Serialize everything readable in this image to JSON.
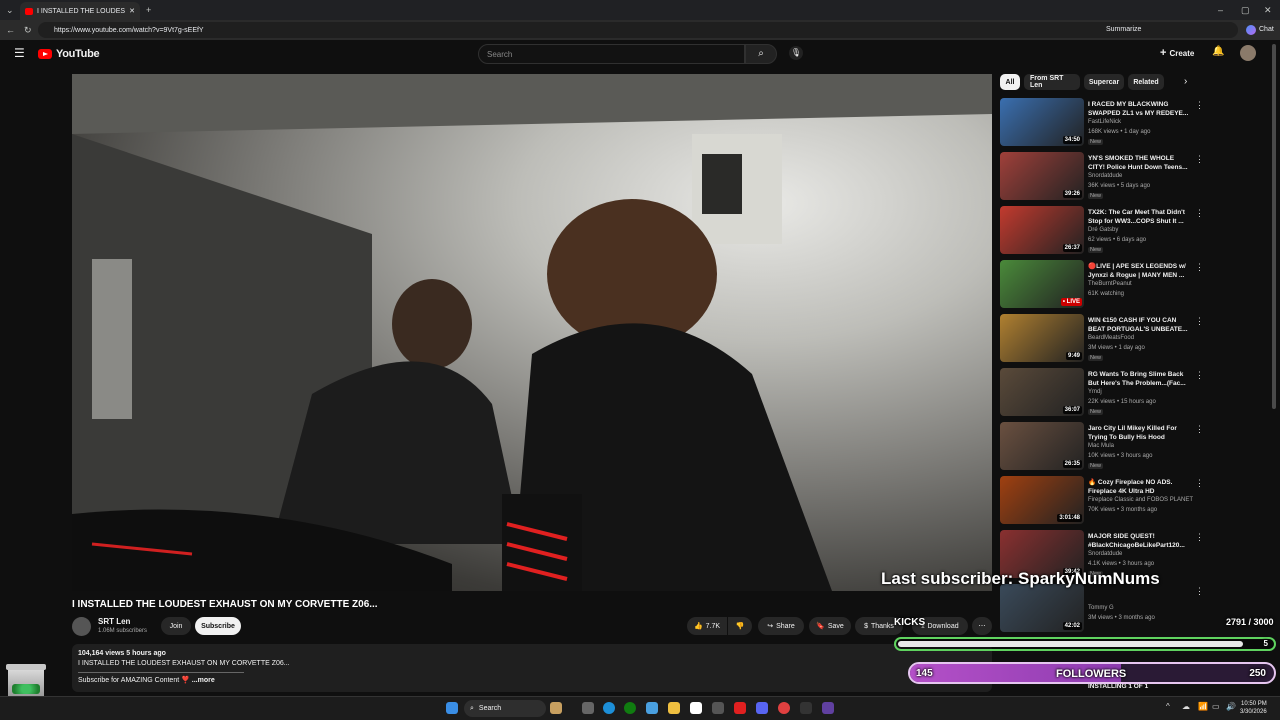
{
  "browser": {
    "tab_title": "I INSTALLED THE LOUDEST EX",
    "url": "https://www.youtube.com/watch?v=9Vt7g-sEEfY",
    "summarize_label": "Summarize",
    "chat_label": "Chat"
  },
  "header": {
    "logo_text": "YouTube",
    "search_placeholder": "Search",
    "create_label": "Create"
  },
  "video": {
    "title": "I INSTALLED THE LOUDEST EXHAUST ON MY CORVETTE Z06...",
    "channel": "SRT Len",
    "subscribers": "1.06M subscribers",
    "join_label": "Join",
    "subscribe_label": "Subscribe",
    "likes": "7.7K",
    "share_label": "Share",
    "save_label": "Save",
    "thanks_label": "Thanks",
    "download_label": "Download"
  },
  "description": {
    "views_time": "104,164 views  5 hours ago",
    "line1": "I INSTALLED THE LOUDEST EXHAUST ON MY CORVETTE Z06...",
    "line2": "Subscribe for AMAZING Content ❣️",
    "more": "...more"
  },
  "chips": [
    "All",
    "From SRT Len",
    "Supercar",
    "Related"
  ],
  "recommendations": [
    {
      "title": "I RACED MY BLACKWING SWAPPED ZL1 vs MY REDEYE...",
      "channel": "FastLifeNick",
      "meta": "168K views • 1 day ago",
      "duration": "34:50",
      "badge": "New",
      "color": "#3a6fb0"
    },
    {
      "title": "YN'S SMOKED THE WHOLE CITY! Police Hunt Down Teens...",
      "channel": "Snordatdude",
      "meta": "36K views • 5 days ago",
      "duration": "39:26",
      "badge": "New",
      "color": "#a0403a"
    },
    {
      "title": "TX2K: The Car Meet That Didn't Stop for WW3...COPS Shut It ...",
      "channel": "Dré Gatsby",
      "meta": "62 views • 6 days ago",
      "duration": "26:37",
      "badge": "New",
      "color": "#c23a2e"
    },
    {
      "title": "🔴LIVE | APE SEX LEGENDS w/ Jynxzi & Rogue | MANY MEN ...",
      "channel": "TheBurntPeanut",
      "meta": "61K watching",
      "duration": "• LIVE",
      "badge": "",
      "color": "#4a8a3a"
    },
    {
      "title": "WIN €150 CASH IF YOU CAN BEAT PORTUGAL'S UNBEATE...",
      "channel": "BeardMeatsFood",
      "meta": "3M views • 1 day ago",
      "duration": "9:49",
      "badge": "New",
      "color": "#b08030"
    },
    {
      "title": "RG Wants To Bring Slime Back But Here's The Problem...(Fac...",
      "channel": "Ymdj",
      "meta": "22K views • 15 hours ago",
      "duration": "36:07",
      "badge": "New",
      "color": "#5a4a3a"
    },
    {
      "title": "Jaro City Lil Mikey Killed For Trying To Bully His Hood",
      "channel": "Mac Mula",
      "meta": "10K views • 3 hours ago",
      "duration": "26:35",
      "badge": "New",
      "color": "#6a5040"
    },
    {
      "title": "🔥 Cozy Fireplace NO ADS. Fireplace 4K Ultra HD",
      "channel": "Fireplace Classic and FOBOS PLANET",
      "meta": "70K views • 3 months ago",
      "duration": "3:01:48",
      "badge": "",
      "color": "#a04010"
    },
    {
      "title": "MAJOR SIDE QUEST! #BlackChicagoBeLikePart120...",
      "channel": "Snordatdude",
      "meta": "4.1K views • 3 hours ago",
      "duration": "39:42",
      "badge": "New",
      "color": "#8a3030"
    },
    {
      "title": "",
      "channel": "Tommy G",
      "meta": "3M views • 3 months ago",
      "duration": "42:02",
      "badge": "",
      "color": "#3a4a5a"
    }
  ],
  "overlay": {
    "last_subscriber": "Last subscriber: SparkyNumNums",
    "kicks": "KICKS",
    "progress_count": "2791 / 3000",
    "sub_goal_value": "5",
    "followers_label": "FOLLOWERS",
    "followers_current": "145",
    "followers_goal": "250",
    "followers_fraction": 0.58
  },
  "partial_items": {
    "bottom_title": "INSTALLING 1 OF 1"
  },
  "taskbar": {
    "search_label": "Search",
    "time": "10:50 PM",
    "date": "3/30/2026"
  }
}
